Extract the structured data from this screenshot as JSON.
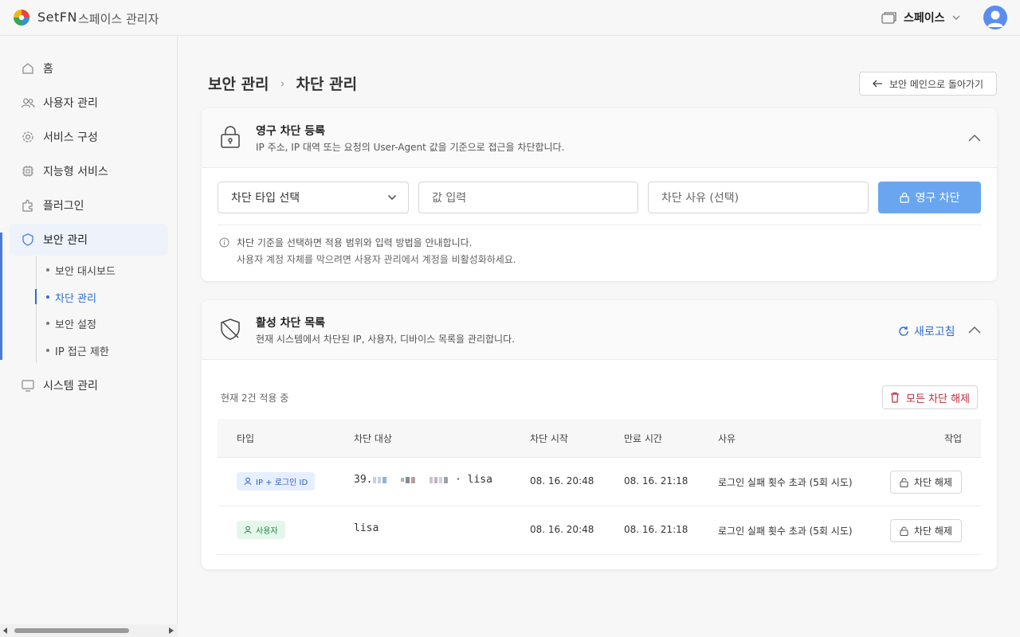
{
  "header": {
    "brand": "SetFN",
    "subtitle": "스페이스 관리자",
    "space_selector_label": "스페이스"
  },
  "sidebar": {
    "items": [
      {
        "label": "홈",
        "icon": "home-icon"
      },
      {
        "label": "사용자 관리",
        "icon": "users-icon"
      },
      {
        "label": "서비스 구성",
        "icon": "gear-icon"
      },
      {
        "label": "지능형 서비스",
        "icon": "chip-icon"
      },
      {
        "label": "플러그인",
        "icon": "puzzle-icon"
      },
      {
        "label": "보안 관리",
        "icon": "shield-icon",
        "active": true
      },
      {
        "label": "시스템 관리",
        "icon": "monitor-icon"
      }
    ],
    "security_sub_items": [
      {
        "label": "보안 대시보드"
      },
      {
        "label": "차단 관리",
        "active": true
      },
      {
        "label": "보안 설정"
      },
      {
        "label": "IP 접근 제한"
      }
    ]
  },
  "page": {
    "breadcrumb_parent": "보안 관리",
    "breadcrumb_separator": "›",
    "breadcrumb_current": "차단 관리",
    "back_button_label": "보안 메인으로 돌아가기"
  },
  "permanent_block": {
    "title": "영구 차단 등록",
    "description": "IP 주소, IP 대역 또는 요청의 User-Agent 값을 기준으로 접근을 차단합니다.",
    "type_select_value": "차단 타입 선택",
    "value_placeholder": "값 입력",
    "reason_placeholder": "차단 사유 (선택)",
    "submit_label": "영구 차단",
    "info_line1": "차단 기준을 선택하면 적용 범위와 입력 방법을 안내합니다.",
    "info_line2": "사용자 계정 자체를 막으려면 사용자 관리에서 계정을 비활성화하세요."
  },
  "active_blocks": {
    "title": "활성 차단 목록",
    "description": "현재 시스템에서 차단된 IP, 사용자, 디바이스 목록을 관리합니다.",
    "refresh_label": "새로고침",
    "count_text": "현재 2건 적용 중",
    "clear_all_label": "모든 차단 해제",
    "columns": [
      "타입",
      "차단 대상",
      "차단 시작",
      "만료 시간",
      "사유",
      "작업"
    ],
    "rows": [
      {
        "type": "IP + 로그인 ID",
        "type_color": "#2d5fbf",
        "target_prefix": "39.",
        "target_suffix": "· lisa",
        "start": "08. 16. 20:48",
        "expire": "08. 16. 21:18",
        "reason": "로그인 실패 횟수 초과 (5회 시도)",
        "action": "차단 해제"
      },
      {
        "type": "사용자",
        "type_color": "#23874a",
        "target": "lisa",
        "start": "08. 16. 20:48",
        "expire": "08. 16. 21:18",
        "reason": "로그인 실패 횟수 초과 (5회 시도)",
        "action": "차단 해제"
      }
    ]
  },
  "colors": {
    "accent": "#2d6ad8",
    "primary_button": "#6aa6ef",
    "danger": "#c0293a"
  }
}
